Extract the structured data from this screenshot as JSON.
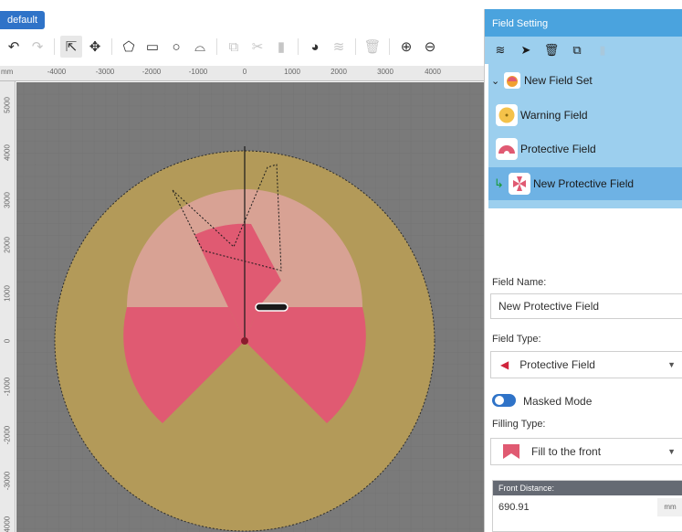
{
  "tab": {
    "label": "default"
  },
  "toolbar": {
    "icons": [
      "undo-icon",
      "redo-icon",
      "select-icon",
      "move-icon",
      "polygon-icon",
      "rectangle-icon",
      "circle-icon",
      "freeform-icon",
      "copy-icon",
      "cut-icon",
      "paste-icon",
      "contour-icon",
      "layers-icon",
      "delete-icon",
      "zoom-in-icon",
      "zoom-out-icon"
    ]
  },
  "ruler": {
    "unit": "mm",
    "top_labels": [
      "-4000",
      "-3000",
      "-2000",
      "-1000",
      "0",
      "1000",
      "2000",
      "3000",
      "4000"
    ],
    "left_labels": [
      "5000",
      "4000",
      "3000",
      "2000",
      "1000",
      "0",
      "-1000",
      "-2000",
      "-3000",
      "-4000"
    ]
  },
  "colors": {
    "accent": "#2f73c8",
    "panel_header": "#4aa3de",
    "panel_bg": "#9ccfee",
    "selected_row": "#6eb2e4",
    "warning_field": "#b39a59",
    "protective_field": "#e05a72",
    "canvas": "#7a7a7a"
  },
  "panel": {
    "title": "Field Setting",
    "toolbar_icons": [
      "layers-icon",
      "pin-icon",
      "trash-icon",
      "copy-icon",
      "paste-icon"
    ],
    "tree": {
      "group": "New Field Set",
      "items": [
        {
          "label": "Warning Field",
          "icon": "warning-field-icon"
        },
        {
          "label": "Protective Field",
          "icon": "protective-field-icon"
        },
        {
          "label": "New Protective Field",
          "icon": "new-protective-field-icon",
          "selected": true
        }
      ]
    },
    "field_name_label": "Field Name:",
    "field_name_value": "New Protective Field",
    "field_type_label": "Field Type:",
    "field_type_value": "Protective Field",
    "masked_mode_label": "Masked Mode",
    "masked_mode_on": true,
    "filling_type_label": "Filling Type:",
    "filling_type_value": "Fill to the front",
    "front_distance_label": "Front Distance:",
    "front_distance_value": "690.91",
    "front_distance_unit": "mm"
  }
}
